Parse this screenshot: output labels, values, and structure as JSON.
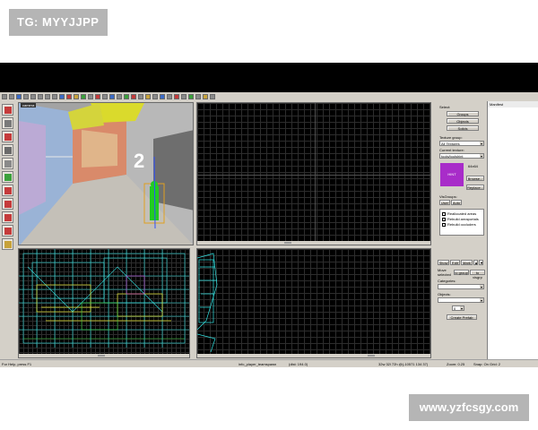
{
  "watermark": {
    "top": "TG: MYYJJPP",
    "bottom": "www.yzfcsgy.com"
  },
  "viewports": {
    "camera_label": "camera"
  },
  "panel": {
    "select_label": "Select:",
    "groups_button": "Groups",
    "objects_button": "Objects",
    "solids_button": "Solids",
    "texture_group_label": "Texture group:",
    "texture_group_value": "All Textures",
    "current_texture_label": "Current texture:",
    "current_texture_value": "tools/toolshint",
    "swatch_text": "HINT",
    "texture_size": "64x64",
    "browse_button": "Browse...",
    "replace_button": "Replace...",
    "visgroups_label": "VisGroups:",
    "tab_user": "User",
    "tab_auto": "Auto",
    "visgroups": [
      "Reallocated areas",
      "Rebuild areaportals",
      "Rebuild occluders"
    ],
    "show_button": "Show",
    "edit_button": "Edit",
    "mark_button": "Mark",
    "move_selected_label": "Move selected",
    "to_group_button": "to group",
    "to_vis_button": "to visgrp",
    "categories_label": "Categories:",
    "objects_label": "Objects:",
    "create_prefab_button": "Create Prefab",
    "spinner_value": "0"
  },
  "manifest": {
    "title": "Manifest"
  },
  "status": {
    "help": "For Help, press F1",
    "entity": "info_player_teamspawn",
    "dist": "(dist: 194.0)",
    "coords": "32w 32l 72h @(-10571 134 37)",
    "zoom": "Zoom: 0.25",
    "snap": "Snap: On Grid: 2"
  }
}
